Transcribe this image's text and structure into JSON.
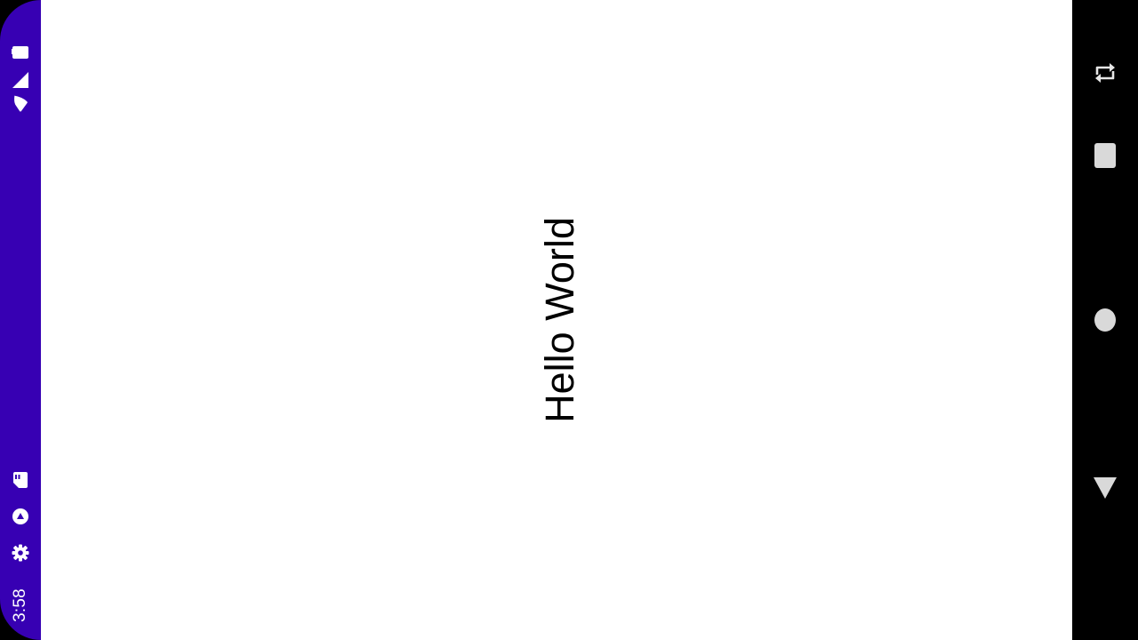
{
  "status_bar": {
    "time": "3:58",
    "color": "#3700B3",
    "icons": [
      "battery-icon",
      "cell-signal-icon",
      "wifi-icon",
      "sd-card-icon",
      "play-store-icon",
      "settings-icon"
    ]
  },
  "app": {
    "text": "Hello World",
    "background": "#FFFFFF"
  },
  "nav_bar": {
    "color": "#000000",
    "buttons": [
      "rotate-button",
      "recents-button",
      "home-button",
      "back-button"
    ]
  }
}
